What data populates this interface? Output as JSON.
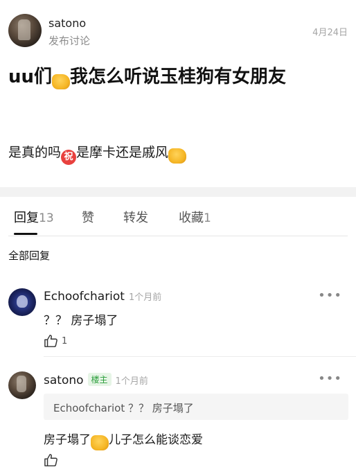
{
  "post": {
    "author": "satono",
    "subtitle": "发布讨论",
    "date": "4月24日",
    "title_part1": "uu们",
    "title_part2": "我怎么听说玉桂狗有女朋友",
    "content_part1": "是真的吗",
    "content_part2": "是摩卡还是戚风",
    "zhu_char": "祝"
  },
  "tabs": [
    {
      "label": "回复",
      "count": "13"
    },
    {
      "label": "赞"
    },
    {
      "label": "转发"
    },
    {
      "label": "收藏",
      "count": "1"
    }
  ],
  "all_replies_label": "全部回复",
  "comments": [
    {
      "author": "Echoofchariot",
      "time": "1个月前",
      "text": "？？ 房子塌了",
      "likes": "1",
      "more": "•••"
    },
    {
      "author": "satono",
      "badge": "楼主",
      "time": "1个月前",
      "quote_author": "Echoofchariot",
      "quote_text": "？？ 房子塌了",
      "text_part1": "房子塌了",
      "text_part2": "儿子怎么能谈恋爱",
      "more": "•••"
    }
  ],
  "icons": {
    "fist": "fist-emoji",
    "zhu": "zhu-emoji",
    "like": "thumbs-up-icon",
    "more": "more-dots-icon"
  }
}
